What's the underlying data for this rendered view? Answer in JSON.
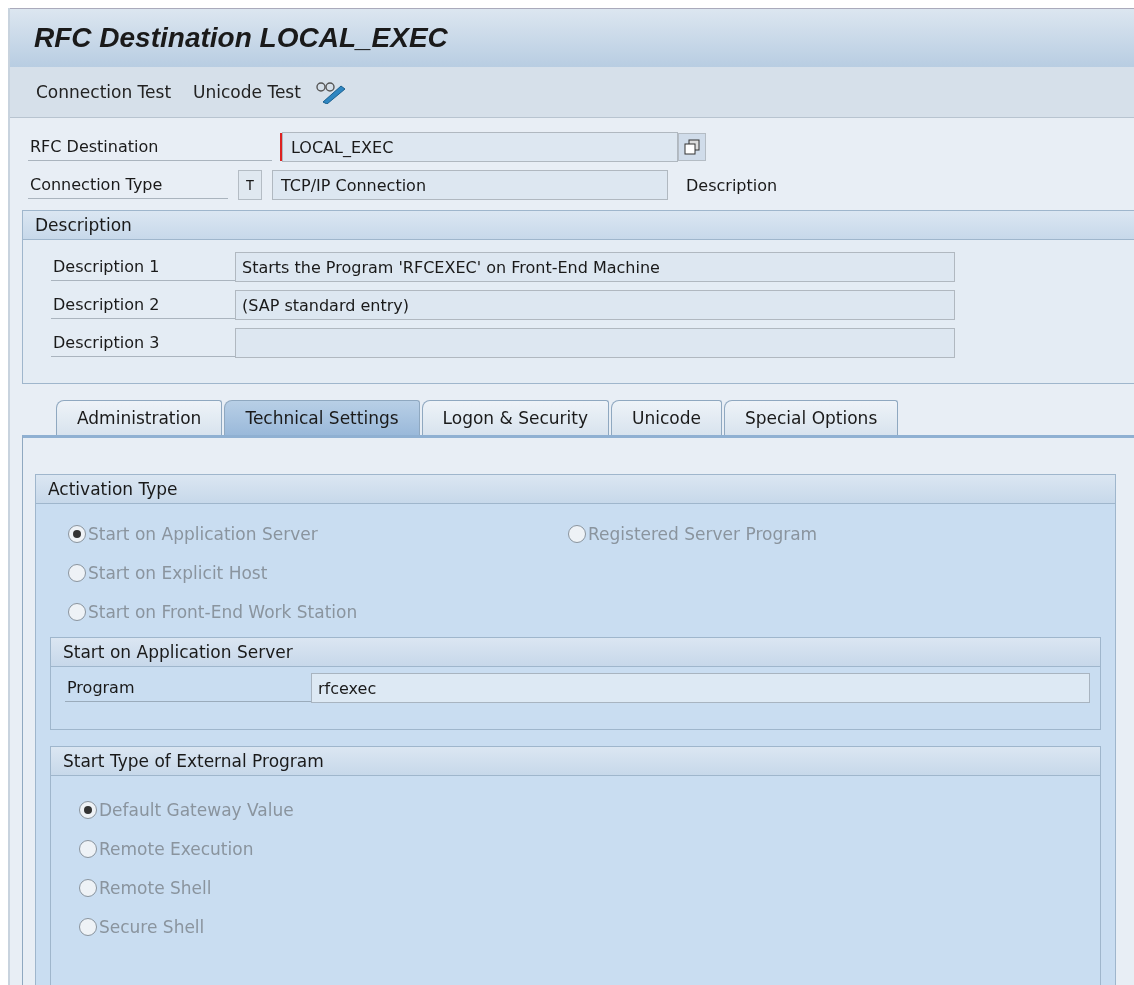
{
  "window": {
    "title": "RFC Destination LOCAL_EXEC"
  },
  "toolbar": [
    {
      "label": "Connection Test"
    },
    {
      "label": "Unicode Test"
    }
  ],
  "header": {
    "destination_label": "RFC Destination",
    "destination_value": "LOCAL_EXEC",
    "type_label": "Connection Type",
    "type_code": "T",
    "type_value": "TCP/IP Connection",
    "type_note": "Description"
  },
  "description_group": {
    "title": "Description",
    "rows": [
      {
        "label": "Description 1",
        "value": "Starts the Program 'RFCEXEC' on Front-End Machine"
      },
      {
        "label": "Description 2",
        "value": "(SAP standard entry)"
      },
      {
        "label": "Description 3",
        "value": ""
      }
    ]
  },
  "tabs": [
    {
      "label": "Administration",
      "selected": false
    },
    {
      "label": "Technical Settings",
      "selected": true
    },
    {
      "label": "Logon & Security",
      "selected": false
    },
    {
      "label": "Unicode",
      "selected": false
    },
    {
      "label": "Special Options",
      "selected": false
    }
  ],
  "activation_type": {
    "title": "Activation Type",
    "rows": [
      [
        {
          "label": "Start on Application Server",
          "selected": true,
          "disabled": true
        },
        {
          "label": "Registered Server Program",
          "selected": false,
          "disabled": true
        }
      ],
      [
        {
          "label": "Start on Explicit Host",
          "selected": false,
          "disabled": true
        }
      ],
      [
        {
          "label": "Start on Front-End Work Station",
          "selected": false,
          "disabled": true
        }
      ]
    ]
  },
  "app_server": {
    "title": "Start on Application Server",
    "program_label": "Program",
    "program_value": "rfcexec"
  },
  "start_type": {
    "title": "Start Type of External Program",
    "options": [
      {
        "label": "Default Gateway Value",
        "selected": true,
        "disabled": true
      },
      {
        "label": "Remote Execution",
        "selected": false,
        "disabled": true
      },
      {
        "label": "Remote Shell",
        "selected": false,
        "disabled": true
      },
      {
        "label": "Secure Shell",
        "selected": false,
        "disabled": true
      }
    ]
  }
}
